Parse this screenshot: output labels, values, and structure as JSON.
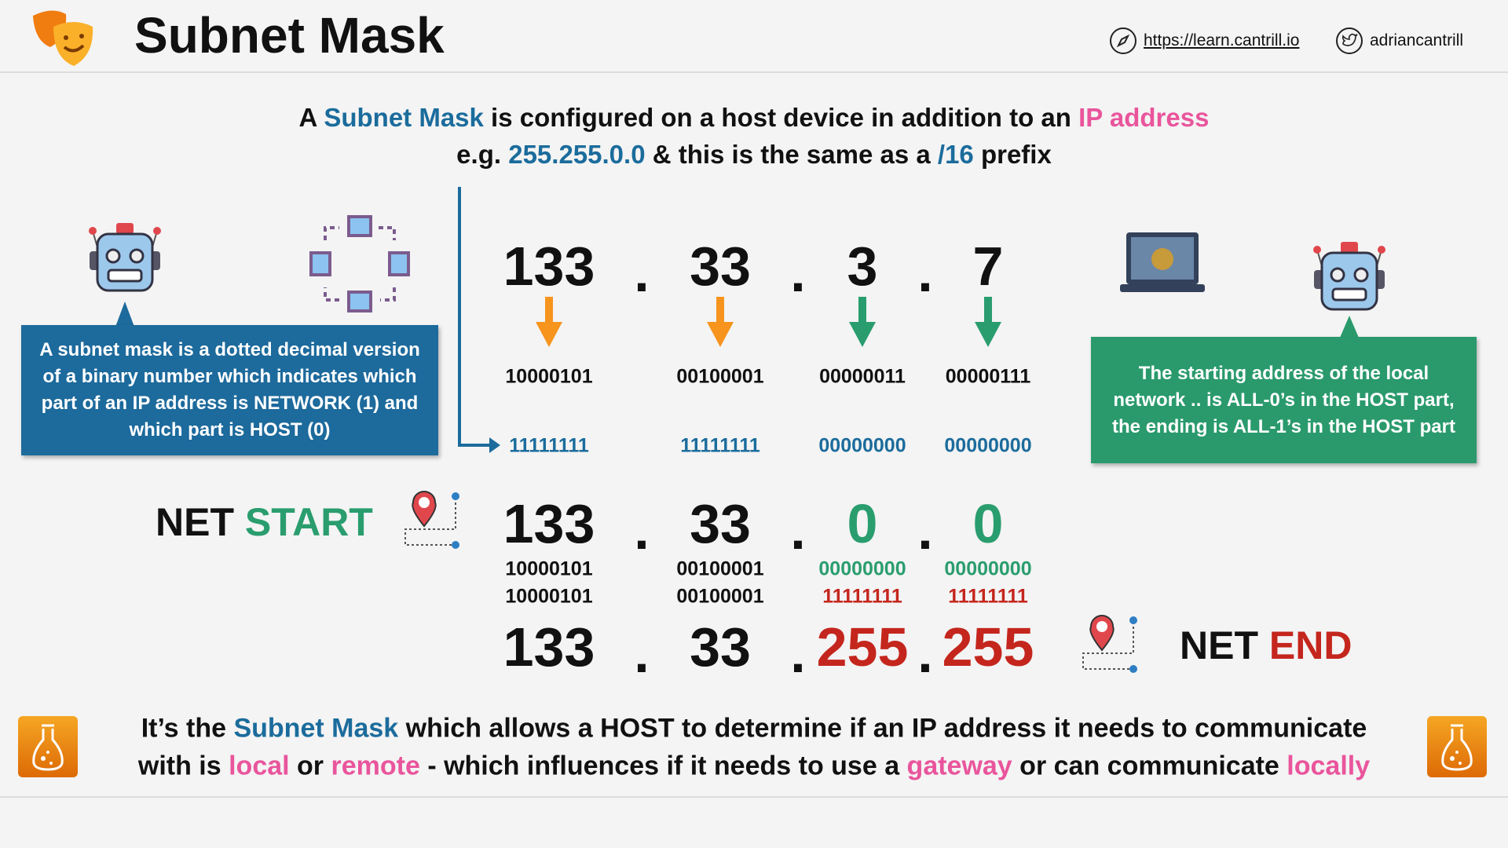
{
  "header": {
    "title": "Subnet Mask",
    "website": "https://learn.cantrill.io",
    "twitter": "adriancantrill"
  },
  "intro": {
    "l1_a": "A ",
    "l1_b": "Subnet Mask",
    "l1_c": " is configured on a host device in addition to an ",
    "l1_d": "IP address",
    "l2_a": "e.g. ",
    "l2_b": "255.255.0.0",
    "l2_c": " & this is the same as a ",
    "l2_d": "/16",
    "l2_e": " prefix"
  },
  "ip": {
    "octets": [
      "133",
      "33",
      "3",
      "7"
    ],
    "binary": [
      "10000101",
      "00100001",
      "00000011",
      "00000111"
    ]
  },
  "mask": {
    "binary": [
      "11111111",
      "11111111",
      "00000000",
      "00000000"
    ]
  },
  "dot": ".",
  "net_start": {
    "label_a": "NET ",
    "label_b": "START",
    "octets": [
      "133",
      "33",
      "0",
      "0"
    ],
    "binary": [
      "10000101",
      "00100001",
      "00000000",
      "00000000"
    ]
  },
  "net_end": {
    "label_a": "NET ",
    "label_b": "END",
    "octets": [
      "133",
      "33",
      "255",
      "255"
    ],
    "binary": [
      "10000101",
      "00100001",
      "11111111",
      "11111111"
    ]
  },
  "left_box": "A subnet mask is a dotted decimal version of a binary number which indicates which part of an IP address is NETWORK (1) and which part is HOST (0)",
  "right_box": "The starting address of the local network .. is ALL-0’s in the HOST part, the ending is ALL-1’s in the HOST part",
  "bottom": {
    "a": "It’s the ",
    "b": "Subnet Mask",
    "c": " which allows a HOST to determine if an IP address it needs to communicate",
    "d": "with is ",
    "e": "local",
    "f": " or ",
    "g": "remote",
    "h": " - which influences if it needs to use a ",
    "i": "gateway",
    "j": " or can communicate ",
    "k": "locally"
  },
  "colors": {
    "blue": "#1b6c9c",
    "pink": "#e9559c",
    "green": "#2a9d6e",
    "red": "#c4261d",
    "orange": "#f7941d",
    "box_blue": "#1d6a9c",
    "box_green": "#2a9a6c"
  }
}
